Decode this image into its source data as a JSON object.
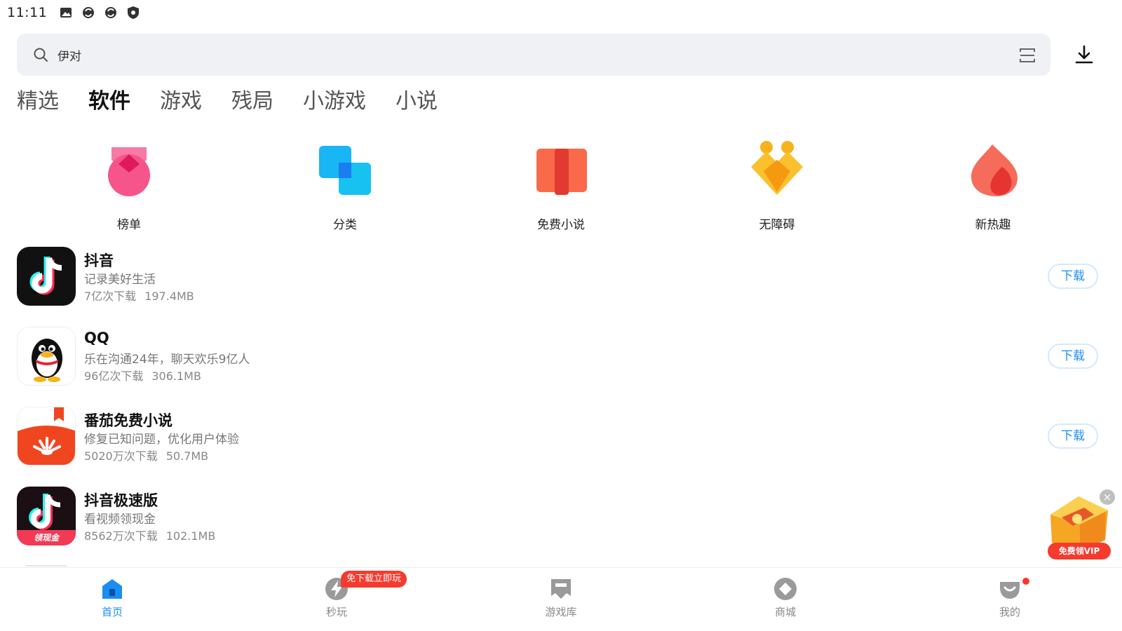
{
  "status_bar": {
    "time": "11:11",
    "icons": [
      "image-icon",
      "sync-icon",
      "sync-icon",
      "shield-icon"
    ]
  },
  "search": {
    "text": "伊对",
    "icon": "search-icon",
    "scan_icon": "scan-icon"
  },
  "download_manager_icon": "download-icon",
  "tabs": [
    {
      "label": "精选",
      "active": false
    },
    {
      "label": "软件",
      "active": true
    },
    {
      "label": "游戏",
      "active": false
    },
    {
      "label": "残局",
      "active": false
    },
    {
      "label": "小游戏",
      "active": false
    },
    {
      "label": "小说",
      "active": false
    }
  ],
  "categories": [
    {
      "label": "榜单",
      "icon": "medal-icon",
      "color": "#f5558a"
    },
    {
      "label": "分类",
      "icon": "category-icon",
      "color": "#1aa7f0"
    },
    {
      "label": "免费小说",
      "icon": "book-icon",
      "color": "#f5553c"
    },
    {
      "label": "无障碍",
      "icon": "heart-hands-icon",
      "color": "#f7a51c"
    },
    {
      "label": "新热趣",
      "icon": "flame-icon",
      "color": "#f14b3c"
    }
  ],
  "apps": [
    {
      "name": "抖音",
      "desc": "记录美好生活",
      "downloads": "7亿次下载",
      "size": "197.4MB",
      "button": "下载",
      "icon": "douyin-icon"
    },
    {
      "name": "QQ",
      "desc": "乐在沟通24年，聊天欢乐9亿人",
      "downloads": "96亿次下载",
      "size": "306.1MB",
      "button": "下载",
      "icon": "qq-penguin-icon"
    },
    {
      "name": "番茄免费小说",
      "desc": "修复已知问题，优化用户体验",
      "downloads": "5020万次下载",
      "size": "50.7MB",
      "button": "下载",
      "icon": "tomato-icon"
    },
    {
      "name": "抖音极速版",
      "desc": "看视频领现金",
      "downloads": "8562万次下载",
      "size": "102.1MB",
      "button": "",
      "icon": "douyin-lite-icon",
      "icon_badge": "领现金"
    }
  ],
  "floating_promo": {
    "label": "免费领VIP",
    "close": "×",
    "icon": "treasure-chest-icon"
  },
  "bottom_nav": [
    {
      "label": "首页",
      "icon": "home-icon",
      "active": true
    },
    {
      "label": "秒玩",
      "icon": "lightning-icon",
      "active": false,
      "badge": "免下载立即玩"
    },
    {
      "label": "游戏库",
      "icon": "bookmark-icon",
      "active": false
    },
    {
      "label": "商城",
      "icon": "diamond-icon",
      "active": false
    },
    {
      "label": "我的",
      "icon": "profile-icon",
      "active": false,
      "dot": true
    }
  ],
  "colors": {
    "accent": "#1a8ef0",
    "badge_red": "#f43b2e",
    "search_bg": "#f0f1f4"
  }
}
